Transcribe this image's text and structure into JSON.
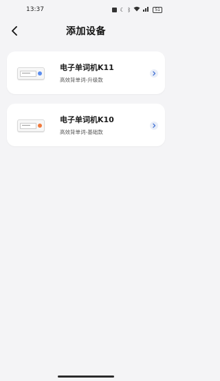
{
  "status_bar": {
    "time": "13:37",
    "battery": "51"
  },
  "header": {
    "title": "添加设备"
  },
  "devices": [
    {
      "name": "电子单词机K11",
      "desc": "高效背单词-升级款",
      "accent": "#5b8def"
    },
    {
      "name": "电子单词机K10",
      "desc": "高效背单词-基础款",
      "accent": "#f07a3c"
    }
  ],
  "icons": {
    "back": "chevron-left-icon",
    "row_arrow": "chevron-right-icon"
  },
  "colors": {
    "background": "#f4f4f6",
    "card": "#ffffff",
    "chevron_circle": "#e9eef8",
    "chevron": "#4a78d6"
  }
}
